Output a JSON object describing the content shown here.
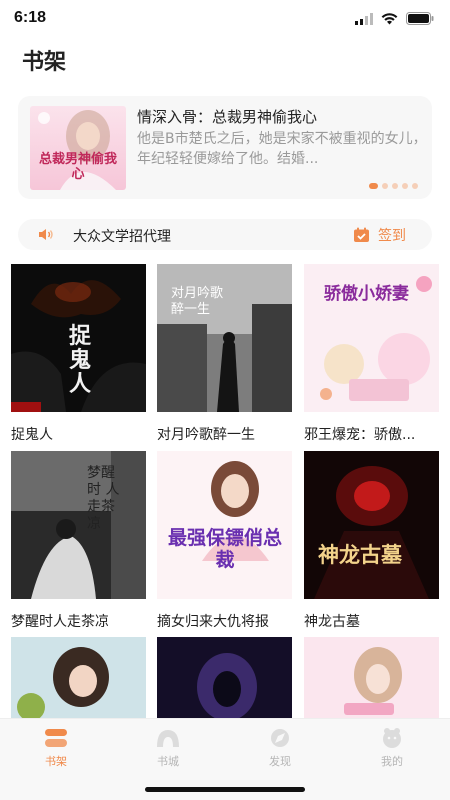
{
  "status_bar": {
    "time": "6:18"
  },
  "page_title": "书架",
  "banner": {
    "title": "情深入骨：总裁男神偷我心",
    "description": "他是B市楚氏之后，她是宋家不被重视的女儿，年纪轻轻便嫁给了他。结婚...",
    "cover_text": "总裁男神偷我心",
    "dots": 5,
    "active_dot": 0
  },
  "notice": {
    "text": "大众文学招代理",
    "signin_label": "签到"
  },
  "books": [
    {
      "title": "捉鬼人",
      "cover_text": "捉鬼人"
    },
    {
      "title": "对月吟歌醉一生",
      "cover_text": "对月吟歌醉一生"
    },
    {
      "title": "邪王爆宠：骄傲...",
      "cover_text": "骄傲小娇妻"
    },
    {
      "title": "梦醒时人走茶凉",
      "cover_text": "梦醒时 人走茶凉"
    },
    {
      "title": "摘女归来大仇将报",
      "cover_text": "最强保镖俏总裁"
    },
    {
      "title": "神龙古墓",
      "cover_text": "神龙古墓"
    },
    {
      "title": "",
      "cover_text": ""
    },
    {
      "title": "",
      "cover_text": ""
    },
    {
      "title": "",
      "cover_text": ""
    }
  ],
  "tabbar": {
    "tabs": [
      {
        "label": "书架",
        "icon": "bookshelf-icon",
        "active": true
      },
      {
        "label": "书城",
        "icon": "bookstore-icon",
        "active": false
      },
      {
        "label": "发现",
        "icon": "discover-icon",
        "active": false
      },
      {
        "label": "我的",
        "icon": "profile-icon",
        "active": false
      }
    ]
  },
  "colors": {
    "accent": "#f08a4b",
    "inactive": "#b5b5b5",
    "panel": "#f7f7f7"
  }
}
